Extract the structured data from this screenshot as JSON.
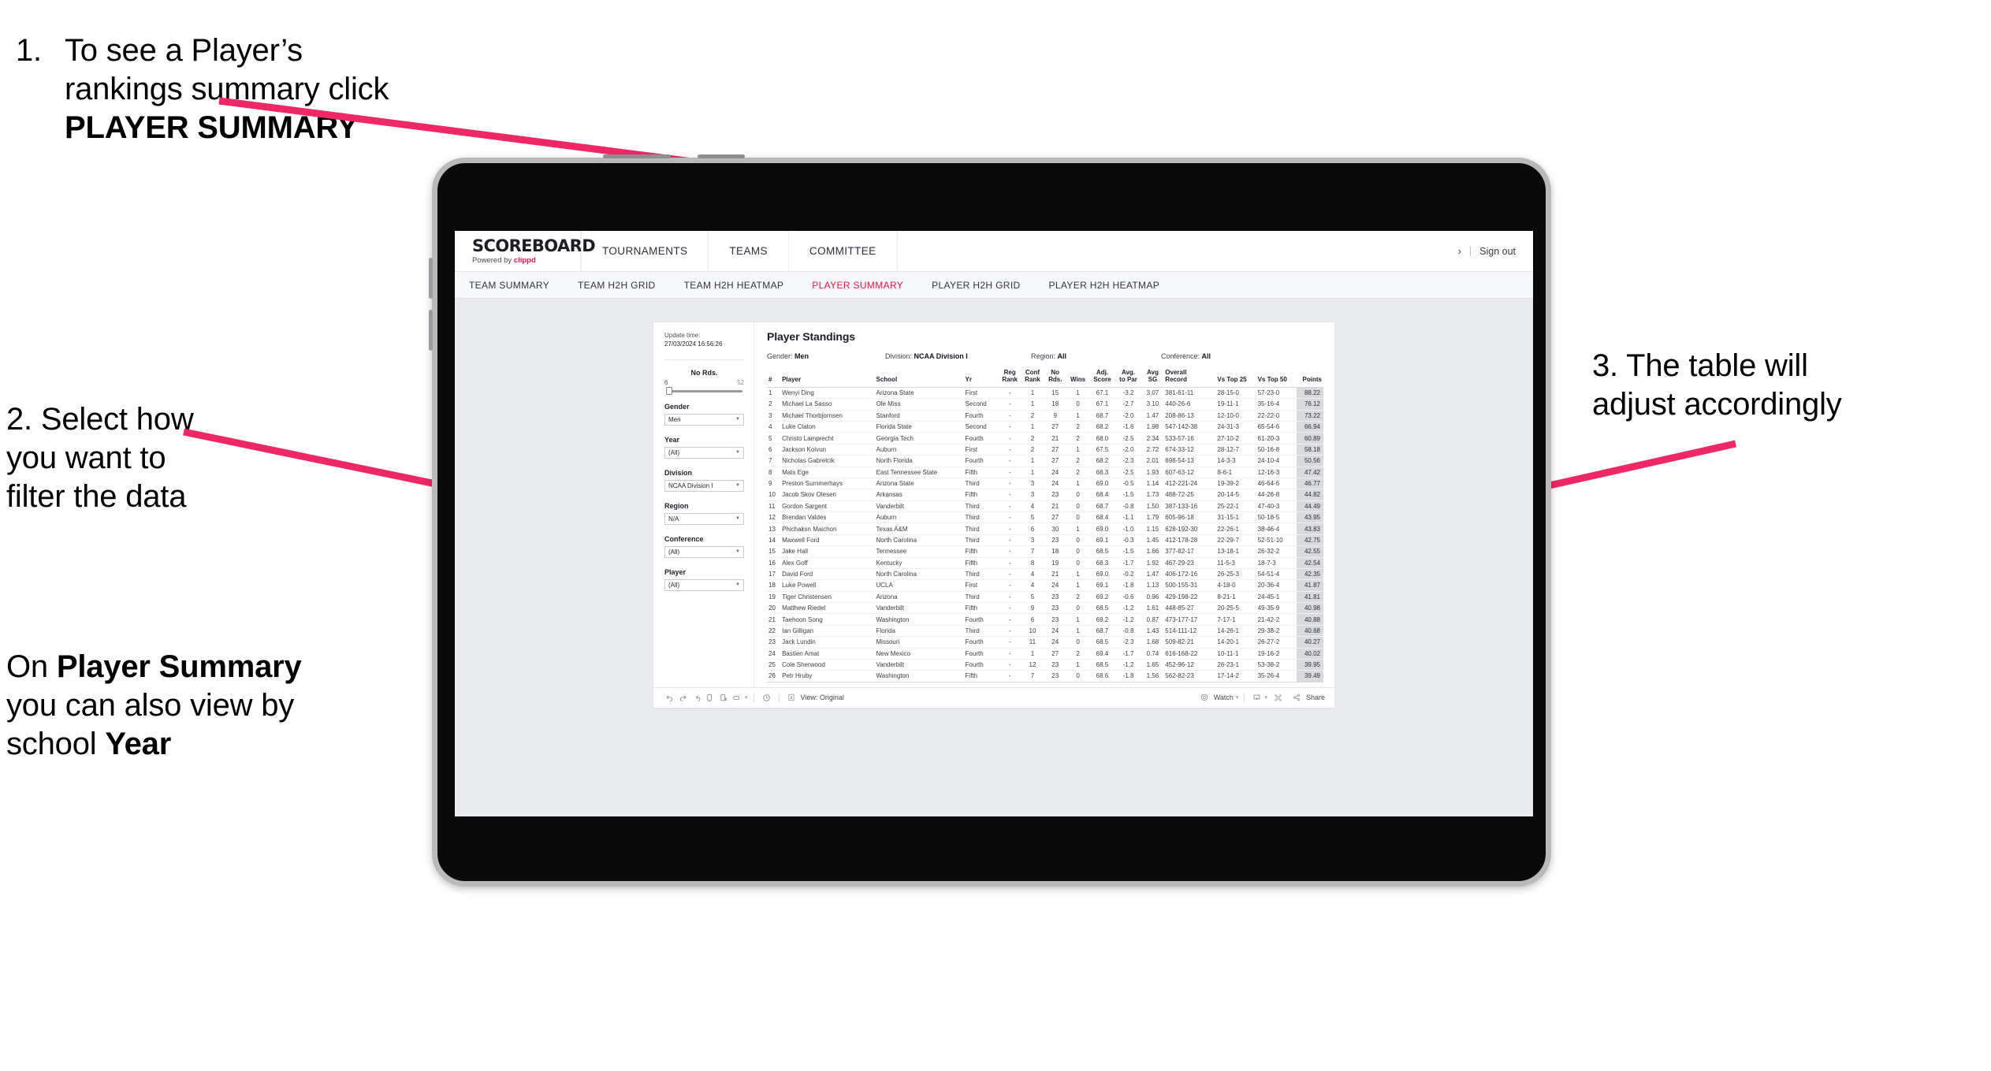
{
  "annotations": {
    "step1": {
      "number": "1.",
      "text_before": "To see a Player’s rankings summary click ",
      "bold": "PLAYER SUMMARY"
    },
    "step2": {
      "line1": "2. Select how",
      "line2": "you want to",
      "line3": "filter the data"
    },
    "step2b": {
      "t1": "On ",
      "b1": "Player Summary",
      "t2": " you can also view by school ",
      "b2": "Year"
    },
    "step3": {
      "line1": "3. The table will",
      "line2": "adjust accordingly"
    }
  },
  "app": {
    "logo": {
      "main": "SCOREBOARD",
      "sub_prefix": "Powered by ",
      "brand": "clippd"
    },
    "topnav": [
      "TOURNAMENTS",
      "TEAMS",
      "COMMITTEE"
    ],
    "user": {
      "chevron": "›",
      "divider": "|",
      "sign_out": "Sign out"
    },
    "subnav": [
      {
        "label": "TEAM SUMMARY",
        "active": false
      },
      {
        "label": "TEAM H2H GRID",
        "active": false
      },
      {
        "label": "TEAM H2H HEATMAP",
        "active": false
      },
      {
        "label": "PLAYER SUMMARY",
        "active": true
      },
      {
        "label": "PLAYER H2H GRID",
        "active": false
      },
      {
        "label": "PLAYER H2H HEATMAP",
        "active": false
      }
    ],
    "accent_color": "#e8124a"
  },
  "filters": {
    "update_label": "Update time:",
    "update_time": "27/03/2024 16:56:26",
    "slider": {
      "label": "No Rds.",
      "min": "6",
      "max": "52"
    },
    "selects": [
      {
        "label": "Gender",
        "value": "Men"
      },
      {
        "label": "Year",
        "value": "(All)"
      },
      {
        "label": "Division",
        "value": "NCAA Division I"
      },
      {
        "label": "Region",
        "value": "N/A"
      },
      {
        "label": "Conference",
        "value": "(All)"
      },
      {
        "label": "Player",
        "value": "(All)"
      }
    ]
  },
  "standings": {
    "title": "Player Standings",
    "meta": [
      {
        "label": "Gender:",
        "value": "Men"
      },
      {
        "label": "Division:",
        "value": "NCAA Division I"
      },
      {
        "label": "Region:",
        "value": "All"
      },
      {
        "label": "Conference:",
        "value": "All"
      }
    ],
    "columns": [
      {
        "l1": "#",
        "l2": ""
      },
      {
        "l1": "Player",
        "l2": ""
      },
      {
        "l1": "School",
        "l2": ""
      },
      {
        "l1": "Yr",
        "l2": ""
      },
      {
        "l1": "Reg",
        "l2": "Rank"
      },
      {
        "l1": "Conf",
        "l2": "Rank"
      },
      {
        "l1": "No",
        "l2": "Rds."
      },
      {
        "l1": "Wins",
        "l2": ""
      },
      {
        "l1": "Adj.",
        "l2": "Score"
      },
      {
        "l1": "Avg.",
        "l2": "to Par"
      },
      {
        "l1": "Avg",
        "l2": "SG"
      },
      {
        "l1": "Overall",
        "l2": "Record"
      },
      {
        "l1": "Vs Top 25",
        "l2": ""
      },
      {
        "l1": "Vs Top 50",
        "l2": ""
      },
      {
        "l1": "Points",
        "l2": ""
      }
    ],
    "rows": [
      [
        "1",
        "Wenyi Ding",
        "Arizona State",
        "First",
        "-",
        "1",
        "15",
        "1",
        "67.1",
        "-3.2",
        "3.07",
        "381-61-11",
        "28-15-0",
        "57-23-0",
        "88.22"
      ],
      [
        "2",
        "Michael La Sasso",
        "Ole Miss",
        "Second",
        "-",
        "1",
        "18",
        "0",
        "67.1",
        "-2.7",
        "3.10",
        "440-26-6",
        "19-11-1",
        "35-16-4",
        "76.12"
      ],
      [
        "3",
        "Michael Thorbjornsen",
        "Stanford",
        "Fourth",
        "-",
        "2",
        "9",
        "1",
        "68.7",
        "-2.0",
        "1.47",
        "208-86-13",
        "12-10-0",
        "22-22-0",
        "73.22"
      ],
      [
        "4",
        "Luke Claton",
        "Florida State",
        "Second",
        "-",
        "1",
        "27",
        "2",
        "68.2",
        "-1.6",
        "1.98",
        "547-142-38",
        "24-31-3",
        "65-54-6",
        "66.94"
      ],
      [
        "5",
        "Christo Lamprecht",
        "Georgia Tech",
        "Fourth",
        "-",
        "2",
        "21",
        "2",
        "68.0",
        "-2.5",
        "2.34",
        "533-57-16",
        "27-10-2",
        "61-20-3",
        "60.89"
      ],
      [
        "6",
        "Jackson Koivun",
        "Auburn",
        "First",
        "-",
        "2",
        "27",
        "1",
        "67.5",
        "-2.0",
        "2.72",
        "674-33-12",
        "28-12-7",
        "50-16-8",
        "58.18"
      ],
      [
        "7",
        "Nicholas Gabrelcik",
        "North Florida",
        "Fourth",
        "-",
        "1",
        "27",
        "2",
        "68.2",
        "-2.3",
        "2.01",
        "698-54-13",
        "14-3-3",
        "24-10-4",
        "50.56"
      ],
      [
        "8",
        "Mats Ege",
        "East Tennessee State",
        "Fifth",
        "-",
        "1",
        "24",
        "2",
        "68.3",
        "-2.5",
        "1.93",
        "607-63-12",
        "8-6-1",
        "12-16-3",
        "47.42"
      ],
      [
        "9",
        "Preston Summerhays",
        "Arizona State",
        "Third",
        "-",
        "3",
        "24",
        "1",
        "69.0",
        "-0.5",
        "1.14",
        "412-221-24",
        "19-39-2",
        "46-64-6",
        "46.77"
      ],
      [
        "10",
        "Jacob Skov Olesen",
        "Arkansas",
        "Fifth",
        "-",
        "3",
        "23",
        "0",
        "68.4",
        "-1.5",
        "1.73",
        "488-72-25",
        "20-14-5",
        "44-26-8",
        "44.82"
      ],
      [
        "11",
        "Gordon Sargent",
        "Vanderbilt",
        "Third",
        "-",
        "4",
        "21",
        "0",
        "68.7",
        "-0.8",
        "1.50",
        "387-133-16",
        "25-22-1",
        "47-40-3",
        "44.49"
      ],
      [
        "12",
        "Brendan Valdes",
        "Auburn",
        "Third",
        "-",
        "5",
        "27",
        "0",
        "68.4",
        "-1.1",
        "1.79",
        "605-96-18",
        "31-15-1",
        "50-18-5",
        "43.95"
      ],
      [
        "13",
        "Phichaksn Maichon",
        "Texas A&M",
        "Third",
        "-",
        "6",
        "30",
        "1",
        "69.0",
        "-1.0",
        "1.15",
        "628-192-30",
        "22-26-1",
        "38-46-4",
        "43.83"
      ],
      [
        "14",
        "Maxwell Ford",
        "North Carolina",
        "Third",
        "-",
        "3",
        "23",
        "0",
        "69.1",
        "-0.3",
        "1.45",
        "412-178-28",
        "22-29-7",
        "52-51-10",
        "42.75"
      ],
      [
        "15",
        "Jake Hall",
        "Tennessee",
        "Fifth",
        "-",
        "7",
        "18",
        "0",
        "68.5",
        "-1.5",
        "1.66",
        "377-82-17",
        "13-18-1",
        "26-32-2",
        "42.55"
      ],
      [
        "16",
        "Alex Goff",
        "Kentucky",
        "Fifth",
        "-",
        "8",
        "19",
        "0",
        "68.3",
        "-1.7",
        "1.92",
        "467-29-23",
        "11-5-3",
        "18-7-3",
        "42.54"
      ],
      [
        "17",
        "David Ford",
        "North Carolina",
        "Third",
        "-",
        "4",
        "21",
        "1",
        "69.0",
        "-0.2",
        "1.47",
        "406-172-16",
        "26-25-3",
        "54-51-4",
        "42.35"
      ],
      [
        "18",
        "Luke Powell",
        "UCLA",
        "First",
        "-",
        "4",
        "24",
        "1",
        "69.1",
        "-1.8",
        "1.13",
        "500-155-31",
        "4-18-0",
        "20-36-4",
        "41.87"
      ],
      [
        "19",
        "Tiger Christensen",
        "Arizona",
        "Third",
        "-",
        "5",
        "23",
        "2",
        "69.2",
        "-0.6",
        "0.96",
        "429-198-22",
        "8-21-1",
        "24-45-1",
        "41.81"
      ],
      [
        "20",
        "Matthew Riedel",
        "Vanderbilt",
        "Fifth",
        "-",
        "9",
        "23",
        "0",
        "68.5",
        "-1.2",
        "1.61",
        "448-85-27",
        "20-25-5",
        "49-35-9",
        "40.98"
      ],
      [
        "21",
        "Taehoon Song",
        "Washington",
        "Fourth",
        "-",
        "6",
        "23",
        "1",
        "69.2",
        "-1.2",
        "0.87",
        "473-177-17",
        "7-17-1",
        "21-42-2",
        "40.88"
      ],
      [
        "22",
        "Ian Gilligan",
        "Florida",
        "Third",
        "-",
        "10",
        "24",
        "1",
        "68.7",
        "-0.8",
        "1.43",
        "514-111-12",
        "14-26-1",
        "29-38-2",
        "40.68"
      ],
      [
        "23",
        "Jack Lundin",
        "Missouri",
        "Fourth",
        "-",
        "11",
        "24",
        "0",
        "68.5",
        "-2.3",
        "1.68",
        "509-82-21",
        "14-20-1",
        "26-27-2",
        "40.27"
      ],
      [
        "24",
        "Bastien Amat",
        "New Mexico",
        "Fourth",
        "-",
        "1",
        "27",
        "2",
        "69.4",
        "-1.7",
        "0.74",
        "616-168-22",
        "10-11-1",
        "19-16-2",
        "40.02"
      ],
      [
        "25",
        "Cole Sherwood",
        "Vanderbilt",
        "Fourth",
        "-",
        "12",
        "23",
        "1",
        "68.5",
        "-1.2",
        "1.65",
        "452-96-12",
        "26-23-1",
        "53-38-2",
        "39.95"
      ],
      [
        "26",
        "Petr Hruby",
        "Washington",
        "Fifth",
        "-",
        "7",
        "23",
        "0",
        "68.6",
        "-1.8",
        "1.56",
        "562-82-23",
        "17-14-2",
        "35-26-4",
        "39.49"
      ]
    ]
  },
  "toolbar": {
    "view_label": "View: Original",
    "watch_label": "Watch",
    "share_label": "Share",
    "caret": "▾"
  }
}
